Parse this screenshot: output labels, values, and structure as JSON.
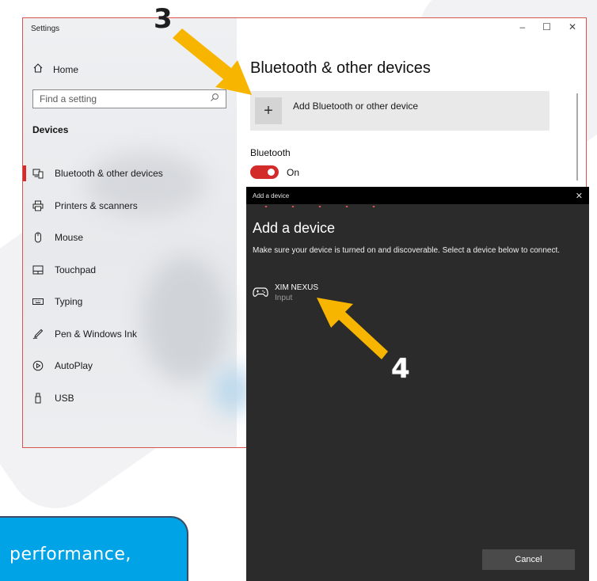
{
  "settings": {
    "window_title": "Settings",
    "controls": {
      "minimize": "–",
      "maximize": "☐",
      "close": "✕"
    },
    "nav": {
      "home_label": "Home",
      "search_placeholder": "Find a setting",
      "section_heading": "Devices",
      "items": [
        {
          "label": "Bluetooth & other devices",
          "icon": "bluetooth-devices-icon",
          "active": true
        },
        {
          "label": "Printers & scanners",
          "icon": "printer-icon"
        },
        {
          "label": "Mouse",
          "icon": "mouse-icon"
        },
        {
          "label": "Touchpad",
          "icon": "touchpad-icon"
        },
        {
          "label": "Typing",
          "icon": "keyboard-icon"
        },
        {
          "label": "Pen & Windows Ink",
          "icon": "pen-icon"
        },
        {
          "label": "AutoPlay",
          "icon": "autoplay-icon"
        },
        {
          "label": "USB",
          "icon": "usb-icon"
        }
      ]
    },
    "content": {
      "title": "Bluetooth & other devices",
      "add_device_label": "Add Bluetooth or other device",
      "bluetooth_label": "Bluetooth",
      "bluetooth_state": "On"
    }
  },
  "dialog": {
    "window_title": "Add a device",
    "close": "✕",
    "heading": "Add a device",
    "description": "Make sure your device is turned on and discoverable. Select a device below to connect.",
    "device": {
      "name": "XIM NEXUS",
      "type": "Input",
      "icon": "gamepad-icon"
    },
    "cancel_label": "Cancel"
  },
  "annotations": {
    "step3": "3",
    "step4": "4",
    "arrow_color": "#f7b500"
  },
  "promo": {
    "text": "performance,"
  },
  "colors": {
    "accent": "#d32a2a",
    "dialog_bg": "#2b2b2b",
    "promo_bg": "#00a3e6"
  }
}
